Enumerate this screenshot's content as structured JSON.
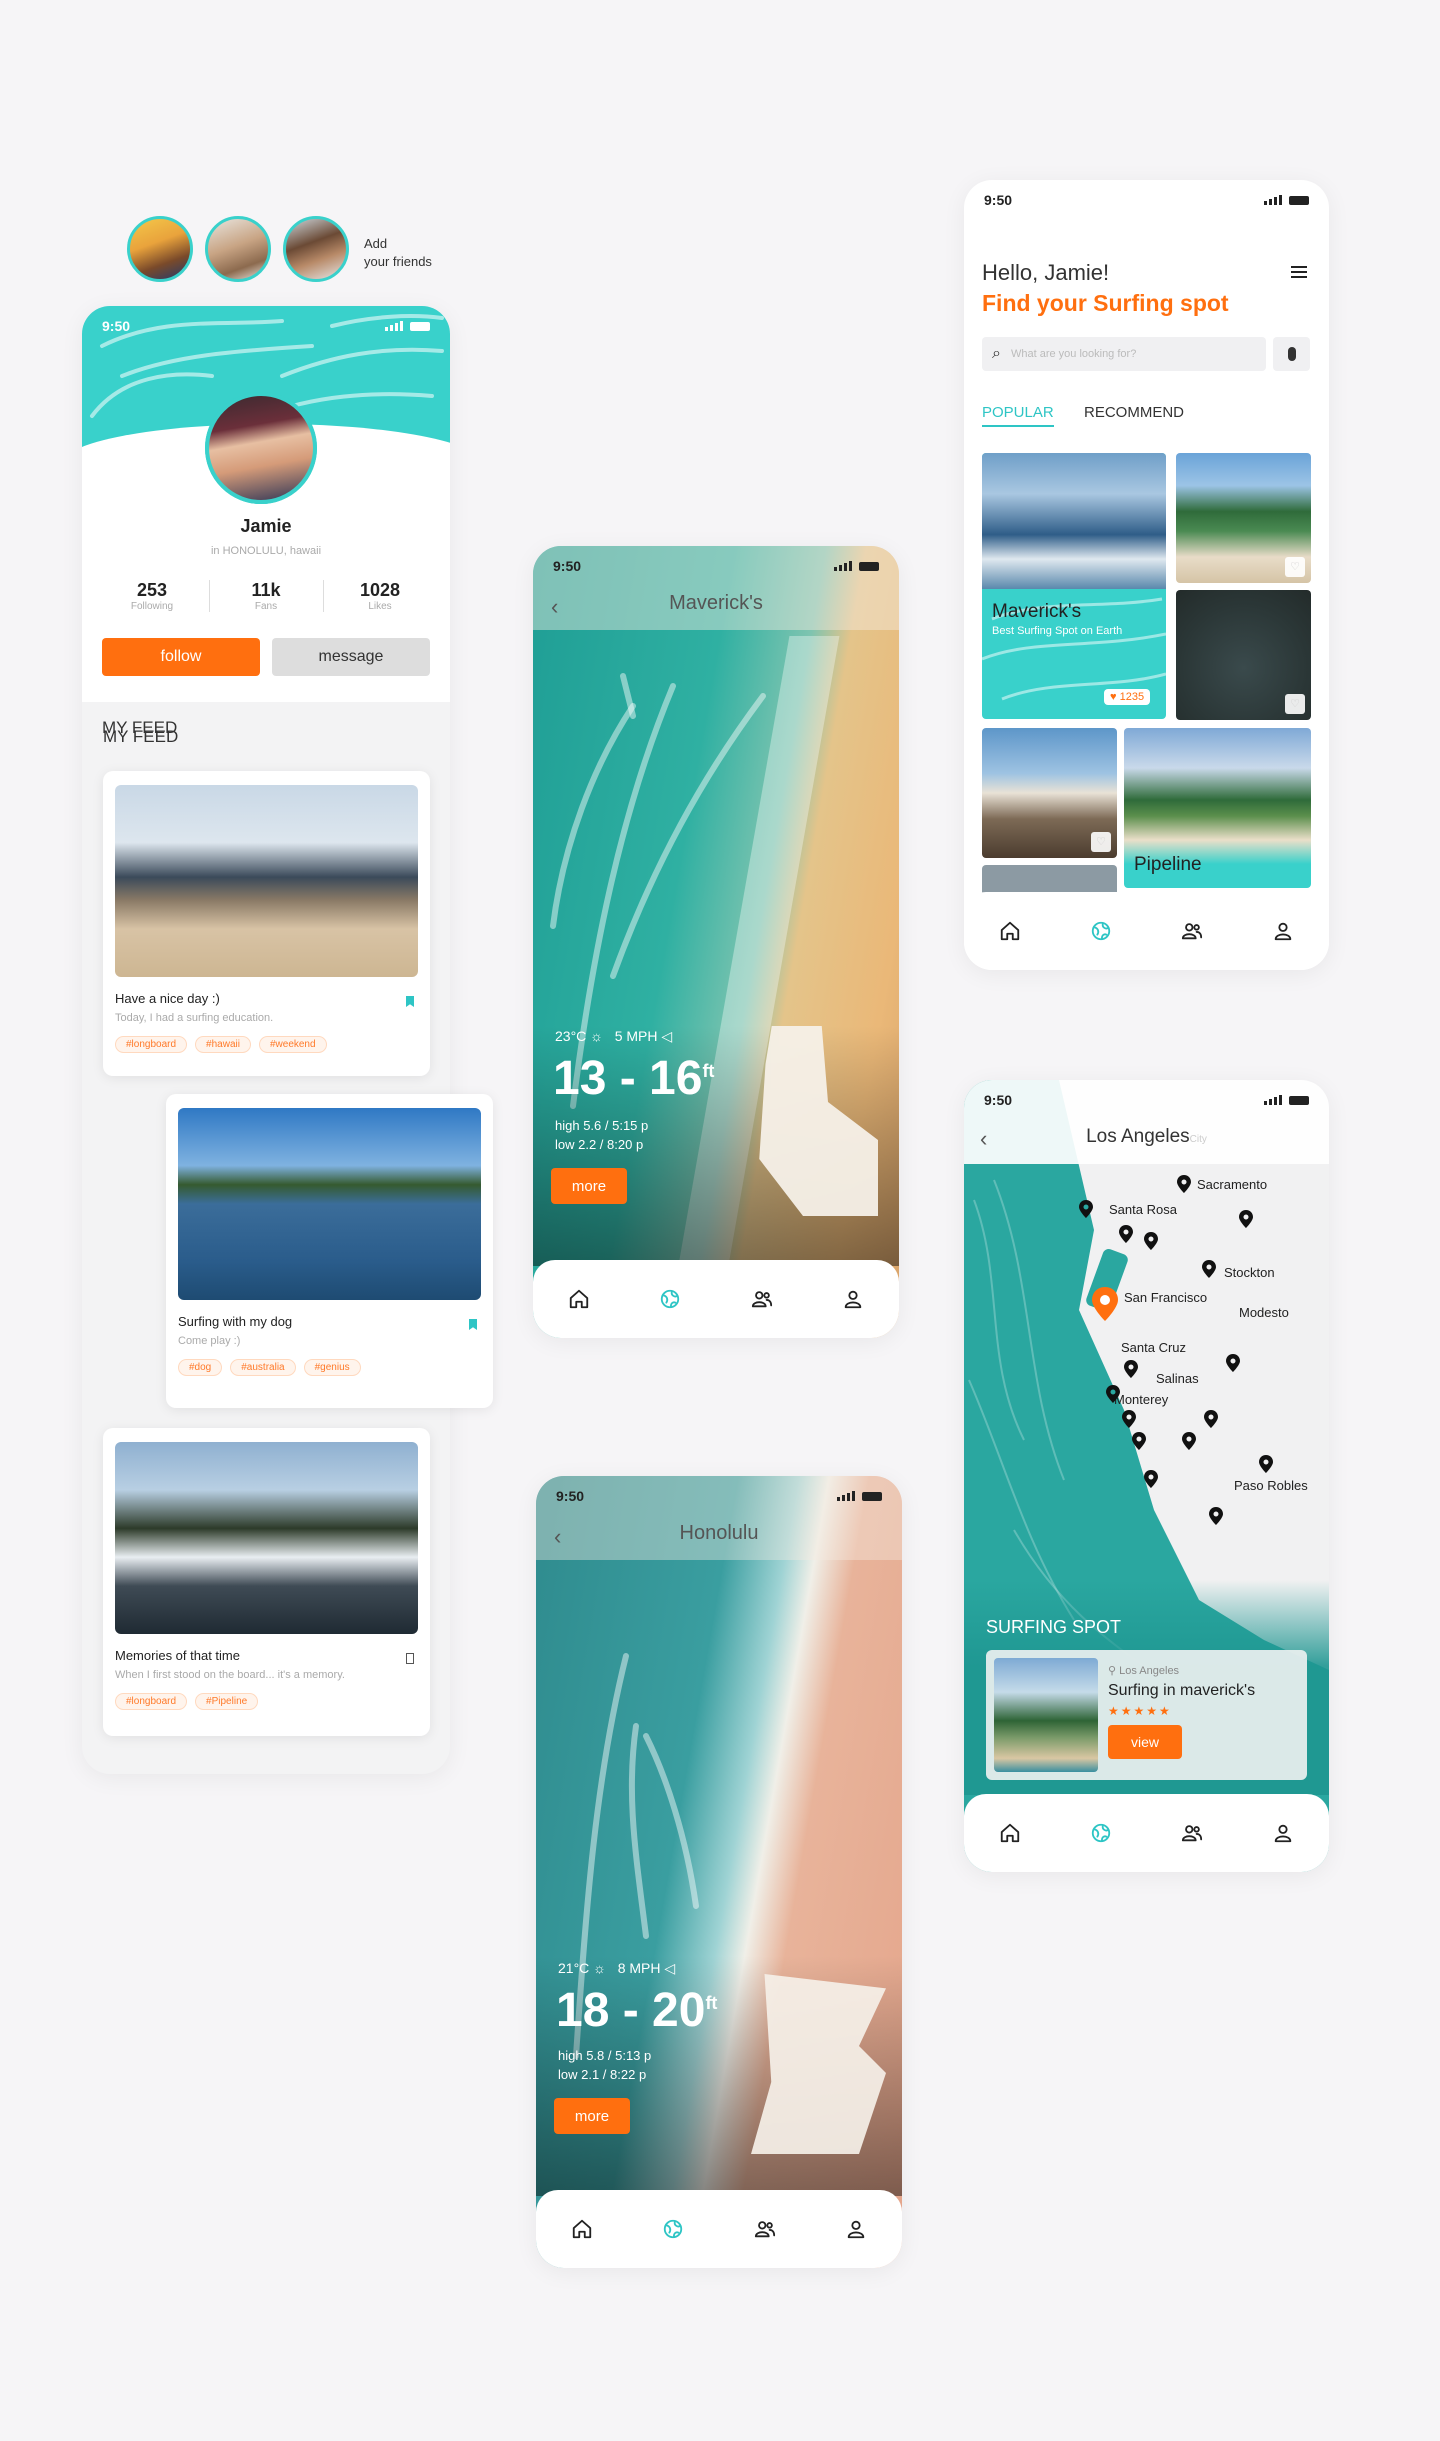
{
  "friends": {
    "add_label": "Add your friends",
    "line1": "Add",
    "line2": "your friends"
  },
  "status_time": "9:50",
  "profile": {
    "name": "Jamie",
    "location": "in HONOLULU, hawaii",
    "stats": [
      {
        "value": "253",
        "label": "Following"
      },
      {
        "value": "11k",
        "label": "Fans"
      },
      {
        "value": "1028",
        "label": "Likes"
      }
    ],
    "follow_label": "follow",
    "message_label": "message",
    "feed_title": "MY FEED",
    "posts": [
      {
        "title": "Have a nice day :)",
        "subtitle": "Today, I had a surfing education.",
        "tags": [
          "#longboard",
          "#hawaii",
          "#weekend"
        ]
      },
      {
        "title": "Surfing with my dog",
        "subtitle": "Come play :)",
        "tags": [
          "#dog",
          "#australia",
          "#genius"
        ]
      },
      {
        "title": "Memories of that time",
        "subtitle": "When I first stood on the board... it's a memory.",
        "tags": [
          "#longboard",
          "#Pipeline"
        ]
      }
    ]
  },
  "mavericks": {
    "title": "Maverick's",
    "temp": "23°C",
    "wind": "5 MPH",
    "range": "13 - 16",
    "unit": "ft",
    "high": "high 5.6 / 5:15 p",
    "low": "low 2.2 / 8:20 p",
    "more": "more"
  },
  "honolulu": {
    "title": "Honolulu",
    "temp": "21°C",
    "wind": "8 MPH",
    "range": "18 - 20",
    "unit": "ft",
    "high": "high 5.8 / 5:13 p",
    "low": "low 2.1 / 8:22 p",
    "more": "more"
  },
  "home": {
    "greeting": "Hello, Jamie!",
    "headline": "Find your Surfing spot",
    "search_placeholder": "What are you looking for?",
    "tabs": [
      "POPULAR",
      "RECOMMEND"
    ],
    "featured_title": "Maverick's",
    "featured_subtitle": "Best Surfing Spot on Earth",
    "featured_likes": "1235",
    "pipeline_title": "Pipeline"
  },
  "map": {
    "title": "Los Angeles",
    "title_suffix": "City",
    "cities": [
      "Sacramento",
      "Santa Rosa",
      "Stockton",
      "San Francisco",
      "Modesto",
      "Santa Cruz",
      "Salinas",
      "Monterey",
      "Paso Robles"
    ],
    "section_title": "SURFING SPOT",
    "spot_location": "Los Angeles",
    "spot_name": "Surfing in maverick's",
    "rating": 4.5,
    "stars": "★★★★★",
    "view_label": "view"
  },
  "colors": {
    "accent": "#ff6f0f",
    "teal": "#2ec5c5",
    "aqua": "#39d1cb"
  },
  "icons": [
    "home-icon",
    "globe-icon",
    "friends-icon",
    "user-icon",
    "search-icon",
    "mic-icon",
    "menu-icon",
    "back-icon",
    "sun-icon",
    "wind-icon",
    "heart-icon",
    "bookmark-icon",
    "pin-icon"
  ]
}
